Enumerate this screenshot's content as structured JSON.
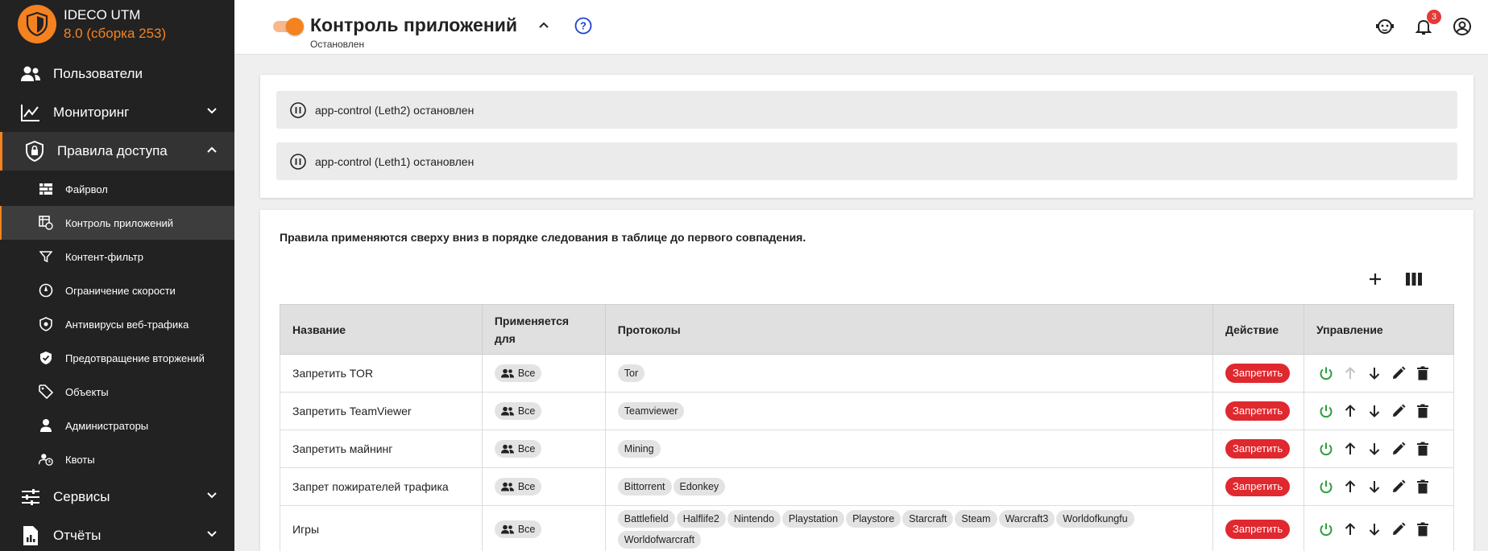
{
  "brand": {
    "name": "IDECO UTM",
    "version": "8.0 (сборка 253)",
    "accent": "#f58220"
  },
  "sidebar": {
    "items": [
      {
        "label": "Пользователи"
      },
      {
        "label": "Мониторинг"
      },
      {
        "label": "Правила доступа"
      },
      {
        "label": "Сервисы"
      },
      {
        "label": "Отчёты"
      }
    ],
    "subitems": [
      {
        "label": "Файрвол"
      },
      {
        "label": "Контроль приложений"
      },
      {
        "label": "Контент-фильтр"
      },
      {
        "label": "Ограничение скорости"
      },
      {
        "label": "Антивирусы веб-трафика"
      },
      {
        "label": "Предотвращение вторжений"
      },
      {
        "label": "Объекты"
      },
      {
        "label": "Администраторы"
      },
      {
        "label": "Квоты"
      }
    ]
  },
  "header": {
    "title": "Контроль приложений",
    "subtitle": "Остановлен",
    "notification_count": "3",
    "service_enabled": true
  },
  "status": [
    {
      "text": "app-control (Leth2) остановлен"
    },
    {
      "text": "app-control (Leth1) остановлен"
    }
  ],
  "rules": {
    "note": "Правила применяются сверху вниз в порядке следования в таблице до первого совпадения.",
    "columns": [
      "Название",
      "Применяется для",
      "Протоколы",
      "Действие",
      "Управление"
    ],
    "rows": [
      {
        "name": "Запретить TOR",
        "applies": "Все",
        "protocols": [
          "Tor"
        ],
        "action": "Запретить"
      },
      {
        "name": "Запретить TeamViewer",
        "applies": "Все",
        "protocols": [
          "Teamviewer"
        ],
        "action": "Запретить"
      },
      {
        "name": "Запретить майнинг",
        "applies": "Все",
        "protocols": [
          "Mining"
        ],
        "action": "Запретить"
      },
      {
        "name": "Запрет пожирателей трафика",
        "applies": "Все",
        "protocols": [
          "Bittorrent",
          "Edonkey"
        ],
        "action": "Запретить"
      },
      {
        "name": "Игры",
        "applies": "Все",
        "protocols": [
          "Battlefield",
          "Halflife2",
          "Nintendo",
          "Playstation",
          "Playstore",
          "Starcraft",
          "Steam",
          "Warcraft3",
          "Worldofkungfu",
          "Worldofwarcraft"
        ],
        "action": "Запретить"
      }
    ]
  },
  "colors": {
    "deny": "#e0282f",
    "power": "#2e9e3e",
    "sidebar": "#222222"
  }
}
